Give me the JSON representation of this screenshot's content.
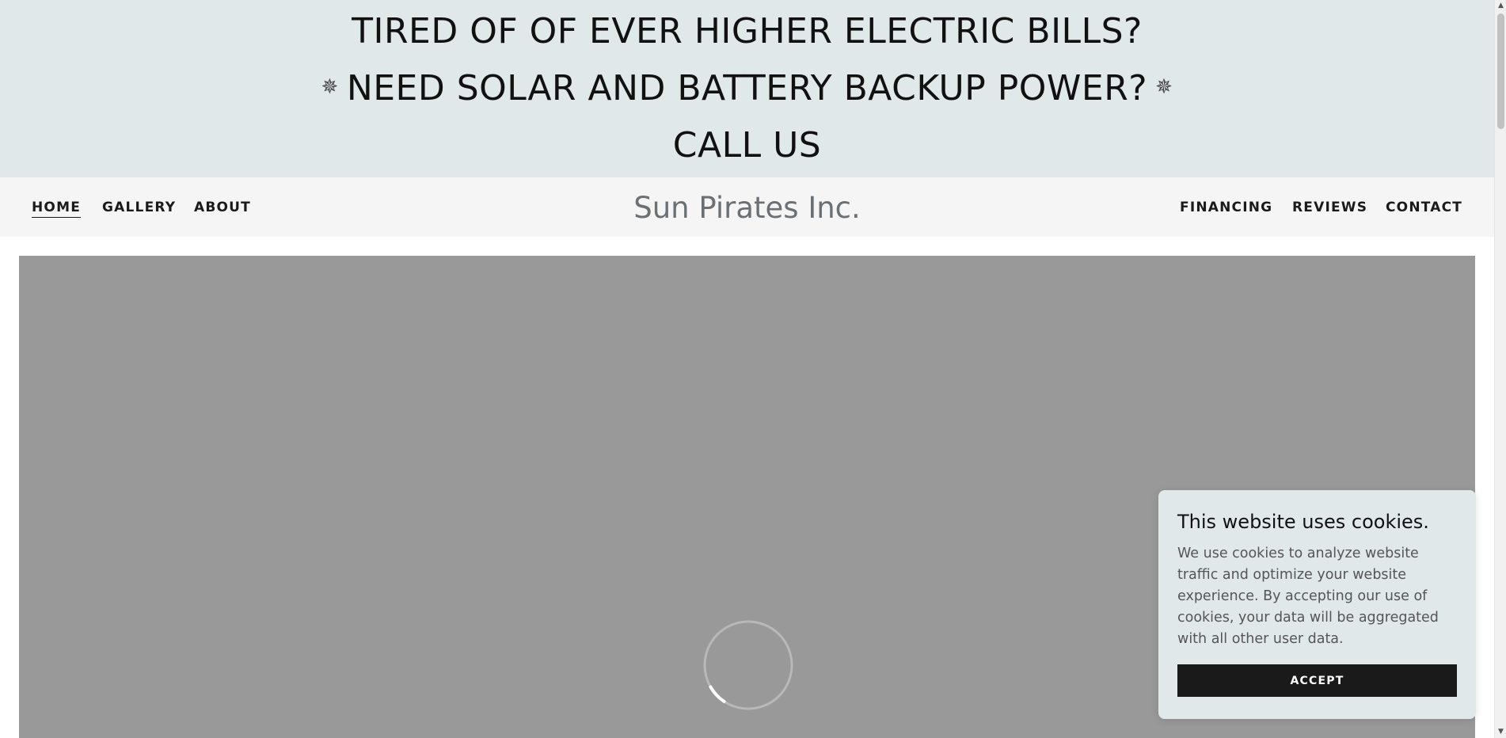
{
  "banner": {
    "line1": "TIRED OF OF EVER HIGHER ELECTRIC BILLS?",
    "line2": "NEED SOLAR AND BATTERY BACKUP POWER?",
    "line3": "CALL US",
    "sparkle_icon": "sparkle-icon"
  },
  "header": {
    "site_title": "Sun Pirates Inc.",
    "nav_left": [
      {
        "label": "HOME"
      },
      {
        "label": "GALLERY"
      },
      {
        "label": "ABOUT"
      }
    ],
    "nav_right": [
      {
        "label": "FINANCING"
      },
      {
        "label": "REVIEWS"
      },
      {
        "label": "CONTACT"
      }
    ],
    "active": "HOME"
  },
  "cookie": {
    "title": "This website uses cookies.",
    "text": "We use cookies to analyze website traffic and optimize your website experience. By accepting our use of cookies, your data will be aggregated with all other user data.",
    "accept_label": "ACCEPT"
  },
  "colors": {
    "banner_bg": "#e0e8ea",
    "header_bg": "#f5f5f5",
    "hero_placeholder": "#999999",
    "button_bg": "#1a1a1a"
  }
}
